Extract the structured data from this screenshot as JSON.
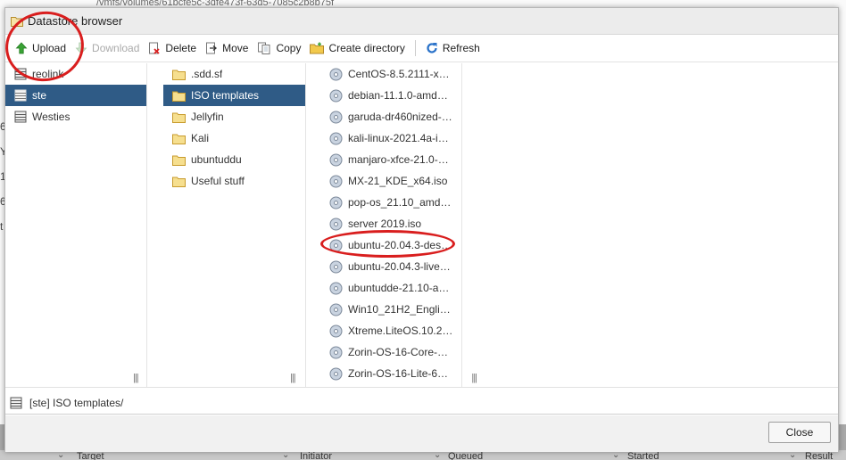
{
  "background": {
    "path_text": "/vmfs/volumes/61bcfe5c-3dfe473f-63d5-7085c2b8b75f",
    "side_chars": [
      "6",
      "Y",
      "1",
      "6",
      "t"
    ],
    "table_columns": [
      "Target",
      "Initiator",
      "Queued",
      "Started",
      "Result"
    ]
  },
  "dialog": {
    "title": "Datastore browser"
  },
  "toolbar": {
    "upload": "Upload",
    "download": "Download",
    "delete": "Delete",
    "move": "Move",
    "copy": "Copy",
    "create_directory": "Create directory",
    "refresh": "Refresh"
  },
  "datastores": [
    {
      "label": "reolink",
      "selected": false
    },
    {
      "label": "ste",
      "selected": true
    },
    {
      "label": "Westies",
      "selected": false
    }
  ],
  "folders": [
    {
      "label": ".sdd.sf",
      "selected": false
    },
    {
      "label": "ISO templates",
      "selected": true
    },
    {
      "label": "Jellyfin",
      "selected": false
    },
    {
      "label": "Kali",
      "selected": false
    },
    {
      "label": "ubuntuddu",
      "selected": false
    },
    {
      "label": "Useful stuff",
      "selected": false
    }
  ],
  "files": [
    "CentOS-8.5.2111-x…",
    "debian-11.1.0-amd…",
    "garuda-dr460nized-…",
    "kali-linux-2021.4a-i…",
    "manjaro-xfce-21.0-…",
    "MX-21_KDE_x64.iso",
    "pop-os_21.10_amd…",
    "server 2019.iso",
    "ubuntu-20.04.3-des…",
    "ubuntu-20.04.3-live…",
    "ubuntudde-21.10-a…",
    "Win10_21H2_Engli…",
    "Xtreme.LiteOS.10.2…",
    "Zorin-OS-16-Core-…",
    "Zorin-OS-16-Lite-6…"
  ],
  "resizer_glyph": "|||",
  "status_path": "[ste] ISO templates/",
  "close_label": "Close",
  "colors": {
    "selection": "#2f5b86",
    "annotation": "#d91e1e",
    "upload_arrow": "#3aa335",
    "refresh": "#2a72c9",
    "folder": "#f2c94c"
  }
}
